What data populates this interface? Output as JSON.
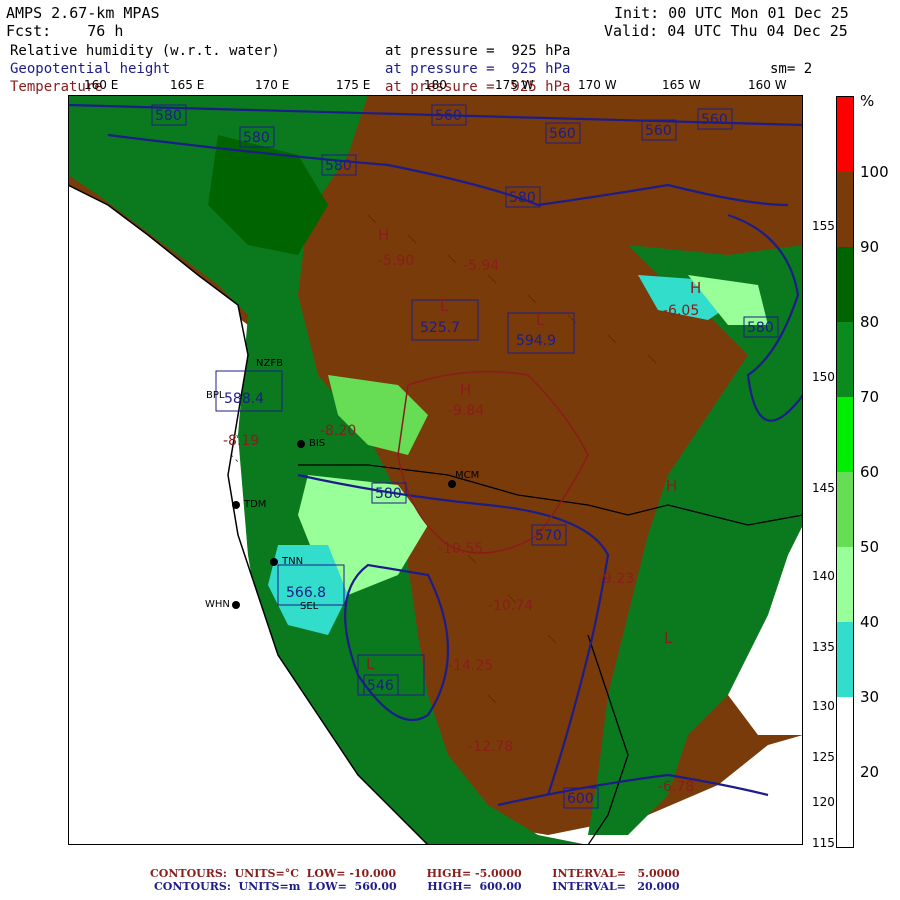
{
  "header": {
    "model": "AMPS 2.67-km MPAS",
    "forecast": "Fcst:    76 h",
    "init": "Init: 00 UTC Mon 01 Dec 25",
    "valid": "Valid: 04 UTC Thu 04 Dec 25",
    "field1_name": "Relative humidity (w.r.t. water)",
    "field1_level": "at pressure =  925 hPa",
    "field2_name": "Geopotential height",
    "field2_level": "at pressure =  925 hPa",
    "field3_name": "Temperature",
    "field3_level": "at pressure =  925 hPa",
    "smoothing": "sm= 2"
  },
  "lon_labels": [
    "160 E",
    "165 E",
    "170 E",
    "175 E",
    "180",
    "175 W",
    "170 W",
    "165 W",
    "160 W"
  ],
  "lat_labels": [
    "155",
    "150",
    "145",
    "140",
    "135",
    "130",
    "125",
    "120",
    "115"
  ],
  "colorbar": {
    "unit": "%",
    "levels": [
      "100",
      "90",
      "80",
      "70",
      "60",
      "50",
      "40",
      "30",
      "20"
    ],
    "colors": [
      "#ff0000",
      "#7a3b0a",
      "#006400",
      "#0b8a1e",
      "#00ee00",
      "#66dd55",
      "#99ff99",
      "#33ddcc",
      "#ffffff"
    ]
  },
  "stations": [
    "BIS",
    "MCM",
    "TDM",
    "TNN",
    "WHN",
    "SEL",
    "BPL",
    "NZFB"
  ],
  "height_labels": [
    "580",
    "580",
    "560",
    "560",
    "560",
    "560",
    "580",
    "580",
    "580",
    "580",
    "570",
    "600",
    "546"
  ],
  "temp_labels": [
    "-5.90",
    "-5.94",
    "-6.05",
    "-9.84",
    "-8.20",
    "-10.55",
    "-10.74",
    "-14.25",
    "-12.78",
    "-9.23",
    "-8.19",
    "-6.78"
  ],
  "highlow_labels": [
    "H",
    "H",
    "H",
    "L",
    "L",
    "L",
    "H",
    "L"
  ],
  "boxed_values": [
    "525.7",
    "594.9",
    "588.4",
    "566.8",
    "546"
  ],
  "footer": {
    "temp_contours": "CONTOURS:  UNITS=°C  LOW= -10.000        HIGH= -5.0000        INTERVAL=   5.0000",
    "height_contours": "CONTOURS:  UNITS=m  LOW=  560.00        HIGH=  600.00        INTERVAL=   20.000"
  }
}
